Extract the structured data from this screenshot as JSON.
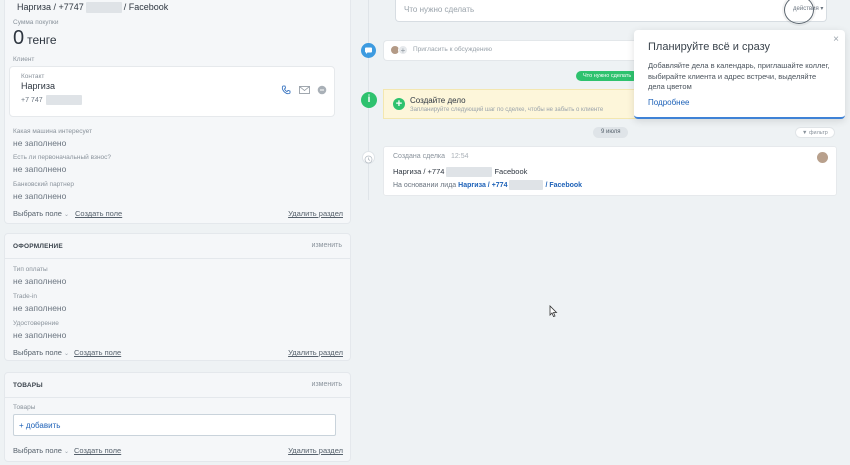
{
  "deal": {
    "title_prefix": "Наргиза / +7747",
    "title_suffix": "/ Facebook",
    "amount_label": "Сумма покупки",
    "amount": "0",
    "currency": "тенге",
    "client_label": "Клиент"
  },
  "contact": {
    "label": "Контакт",
    "name": "Наргиза",
    "phone_prefix": "+7 747"
  },
  "fields_main": [
    {
      "label": "Какая машина интересует",
      "value": "не заполнено"
    },
    {
      "label": "Есть ли первоначальный взнос?",
      "value": "не заполнено"
    },
    {
      "label": "Банковский партнер",
      "value": "не заполнено"
    }
  ],
  "footer": {
    "select_field": "Выбрать поле",
    "create_field": "Создать поле",
    "delete_section": "Удалить раздел",
    "change": "изменить"
  },
  "section_oformlenie": {
    "title": "ОФОРМЛЕНИЕ",
    "fields": [
      {
        "label": "Тип оплаты",
        "value": "не заполнено"
      },
      {
        "label": "Trade-in",
        "value": "не заполнено"
      },
      {
        "label": "Удостоверение",
        "value": "не заполнено"
      }
    ]
  },
  "section_tovary": {
    "title": "ТОВАРЫ",
    "goods_label": "Товары",
    "add_label": "+ добавить"
  },
  "timeline": {
    "todo_placeholder": "Что нужно сделать",
    "actions_label": "действия",
    "discuss_placeholder": "Пригласить к обсуждению",
    "todo_pill": "Что нужно сделать",
    "create_task_title": "Создайте дело",
    "create_task_hint": "Запланируйте следующий шаг по сделке, чтобы не забыть о клиенте",
    "date_pill": "9 июля",
    "filter_label": "фильтр",
    "event_title": "Создана сделка",
    "event_time": "12:54",
    "event_line2_prefix": "Наргиза / +774",
    "event_line2_suffix": "Facebook",
    "event_line3_prefix": "На основании лида",
    "event_link_prefix": "Наргиза / +774",
    "event_link_suffix": "/ Facebook"
  },
  "popover": {
    "title": "Планируйте всё и сразу",
    "body": "Добавляйте дела в календарь, приглашайте коллег, выбирайте клиента и адрес встречи, выделяйте дела цветом",
    "more": "Подробнее",
    "close": "×"
  },
  "colors": {
    "accent_blue": "#3f82d6",
    "green": "#2ec26e",
    "link": "#1e62b8",
    "background": "#eef2f4"
  }
}
